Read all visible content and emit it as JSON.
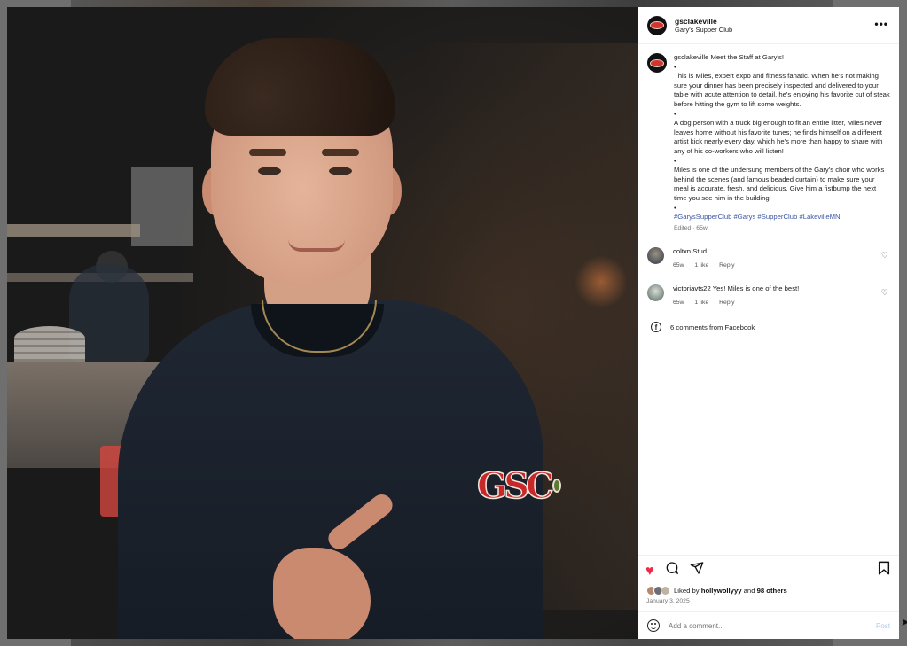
{
  "post": {
    "account": "gsclakeville",
    "location": "Gary's Supper Club",
    "more_icon": "more-horizontal-icon"
  },
  "caption": {
    "user": "gsclakeville",
    "lines": [
      "gsclakeville Meet the Staff at Gary's!",
      "•",
      "This is Miles, expert expo and fitness fanatic. When he's not making sure your dinner has been precisely inspected and delivered to your table with acute attention to detail, he's enjoying his favorite cut of steak before hitting the gym to lift some weights.",
      "•",
      "A dog person with a truck big enough to fit an entire litter, Miles never leaves home without his favorite tunes; he finds himself on a different artist kick nearly every day, which he's more than happy to share with any of his co-workers who will listen!",
      "•",
      "Miles is one of the undersung members of the Gary's choir who works behind the scenes (and famous beaded curtain) to make sure your meal is accurate, fresh, and delicious. Give him a fistbump the next time you see him in the building!",
      "•"
    ],
    "hashtags": "#GarysSupperClub #Garys #SupperClub #LakevilleMN",
    "meta": "Edited · 65w"
  },
  "comments": [
    {
      "user": "coltxn",
      "text": "Stud",
      "age": "65w",
      "likes": "1 like",
      "reply": "Reply"
    },
    {
      "user": "victoriavts22",
      "text": "Yes! Miles is one of the best!",
      "age": "65w",
      "likes": "1 like",
      "reply": "Reply"
    }
  ],
  "facebook_comments": "6 comments from Facebook",
  "actions": {
    "like_icon": "heart-filled-icon",
    "comment_icon": "comment-icon",
    "share_icon": "share-icon",
    "save_icon": "bookmark-icon"
  },
  "likes": {
    "prefix": "Liked by",
    "user": "hollywollyyy",
    "and": "and",
    "others": "98 others"
  },
  "date": "January 3, 2025",
  "comment_box": {
    "placeholder": "Add a comment...",
    "post_label": "Post"
  },
  "photo": {
    "shirt_logo": "GSC"
  },
  "colors": {
    "like_red": "#ed2a47",
    "hashtag_blue": "#3b54a5",
    "post_disabled": "#b3c9ea"
  }
}
